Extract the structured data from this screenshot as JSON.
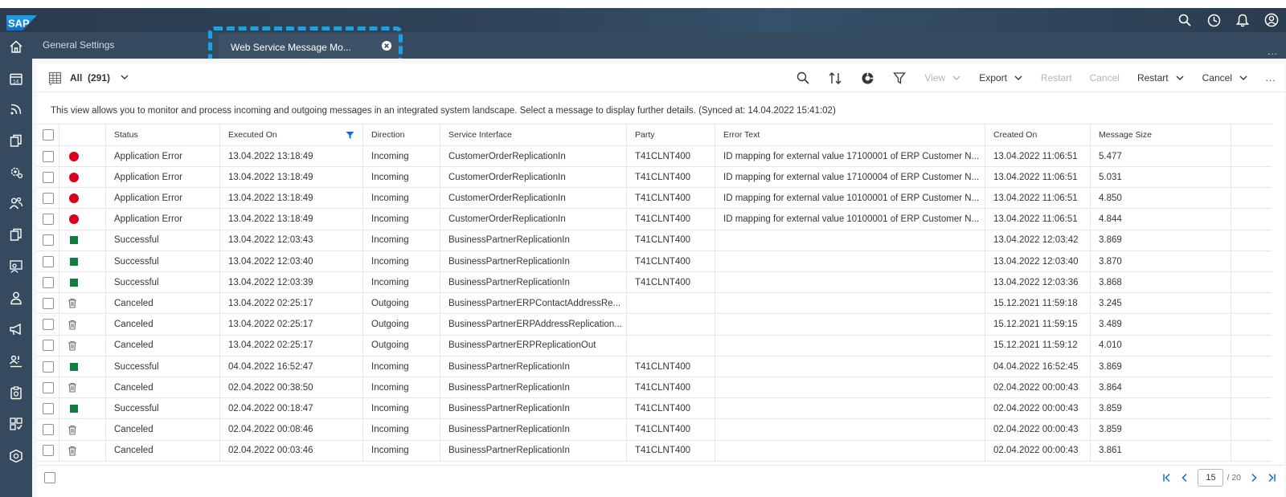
{
  "shell": {
    "logo_text": "SAP",
    "top_icons": [
      "search-icon",
      "history-icon",
      "bell-icon",
      "user-icon"
    ],
    "side_icons": [
      "home-icon",
      "calendar-icon",
      "feed-icon",
      "copy-icon",
      "gear-cluster-icon",
      "people-icon",
      "documents-icon",
      "team-icon",
      "person-icon",
      "megaphone-icon",
      "approval-icon",
      "clipboard-icon",
      "product-icon",
      "shield-icon"
    ]
  },
  "tabs": {
    "general": "General Settings",
    "active": "Web Service Message Mo...",
    "more": "..."
  },
  "toolbar": {
    "title": "All",
    "count": "(291)",
    "view_label": "View",
    "export_label": "Export",
    "restart_disabled": "Restart",
    "cancel_disabled": "Cancel",
    "restart_label": "Restart",
    "cancel_label": "Cancel",
    "more": "..."
  },
  "info": "This view allows you to monitor and process incoming and outgoing messages in an integrated system landscape. Select a message to display further details. (Synced at: 14.04.2022 15:41:02)",
  "columns": [
    "Status",
    "Executed On",
    "Direction",
    "Service Interface",
    "Party",
    "Error Text",
    "Created On",
    "Message Size"
  ],
  "rows": [
    {
      "icon": "error",
      "status": "Application Error",
      "executed": "13.04.2022 13:18:49",
      "direction": "Incoming",
      "service": "CustomerOrderReplicationIn",
      "party": "T41CLNT400",
      "error": "ID mapping for external value 17100001 of ERP Customer N...",
      "created": "13.04.2022 11:06:51",
      "size": "5.477"
    },
    {
      "icon": "error",
      "status": "Application Error",
      "executed": "13.04.2022 13:18:49",
      "direction": "Incoming",
      "service": "CustomerOrderReplicationIn",
      "party": "T41CLNT400",
      "error": "ID mapping for external value 17100004 of ERP Customer N...",
      "created": "13.04.2022 11:06:51",
      "size": "5.031"
    },
    {
      "icon": "error",
      "status": "Application Error",
      "executed": "13.04.2022 13:18:49",
      "direction": "Incoming",
      "service": "CustomerOrderReplicationIn",
      "party": "T41CLNT400",
      "error": "ID mapping for external value 10100001 of ERP Customer N...",
      "created": "13.04.2022 11:06:51",
      "size": "4.850"
    },
    {
      "icon": "error",
      "status": "Application Error",
      "executed": "13.04.2022 13:18:49",
      "direction": "Incoming",
      "service": "CustomerOrderReplicationIn",
      "party": "T41CLNT400",
      "error": "ID mapping for external value 10100001 of ERP Customer N...",
      "created": "13.04.2022 11:06:51",
      "size": "4.844"
    },
    {
      "icon": "success",
      "status": "Successful",
      "executed": "13.04.2022 12:03:43",
      "direction": "Incoming",
      "service": "BusinessPartnerReplicationIn",
      "party": "T41CLNT400",
      "error": "",
      "created": "13.04.2022 12:03:42",
      "size": "3.869"
    },
    {
      "icon": "success",
      "status": "Successful",
      "executed": "13.04.2022 12:03:40",
      "direction": "Incoming",
      "service": "BusinessPartnerReplicationIn",
      "party": "T41CLNT400",
      "error": "",
      "created": "13.04.2022 12:03:40",
      "size": "3.870"
    },
    {
      "icon": "success",
      "status": "Successful",
      "executed": "13.04.2022 12:03:39",
      "direction": "Incoming",
      "service": "BusinessPartnerReplicationIn",
      "party": "T41CLNT400",
      "error": "",
      "created": "13.04.2022 12:03:36",
      "size": "3.868"
    },
    {
      "icon": "canceled",
      "status": "Canceled",
      "executed": "13.04.2022 02:25:17",
      "direction": "Outgoing",
      "service": "BusinessPartnerERPContactAddressRe...",
      "party": "",
      "error": "",
      "created": "15.12.2021 11:59:18",
      "size": "3.245"
    },
    {
      "icon": "canceled",
      "status": "Canceled",
      "executed": "13.04.2022 02:25:17",
      "direction": "Outgoing",
      "service": "BusinessPartnerERPAddressReplication...",
      "party": "",
      "error": "",
      "created": "15.12.2021 11:59:15",
      "size": "3.489"
    },
    {
      "icon": "canceled",
      "status": "Canceled",
      "executed": "13.04.2022 02:25:17",
      "direction": "Outgoing",
      "service": "BusinessPartnerERPReplicationOut",
      "party": "",
      "error": "",
      "created": "15.12.2021 11:59:12",
      "size": "4.010"
    },
    {
      "icon": "success",
      "status": "Successful",
      "executed": "04.04.2022 16:52:47",
      "direction": "Incoming",
      "service": "BusinessPartnerReplicationIn",
      "party": "T41CLNT400",
      "error": "",
      "created": "04.04.2022 16:52:45",
      "size": "3.869"
    },
    {
      "icon": "canceled",
      "status": "Canceled",
      "executed": "02.04.2022 00:38:50",
      "direction": "Incoming",
      "service": "BusinessPartnerReplicationIn",
      "party": "T41CLNT400",
      "error": "",
      "created": "02.04.2022 00:00:43",
      "size": "3.864"
    },
    {
      "icon": "success",
      "status": "Successful",
      "executed": "02.04.2022 00:18:47",
      "direction": "Incoming",
      "service": "BusinessPartnerReplicationIn",
      "party": "T41CLNT400",
      "error": "",
      "created": "02.04.2022 00:00:43",
      "size": "3.859"
    },
    {
      "icon": "canceled",
      "status": "Canceled",
      "executed": "02.04.2022 00:08:46",
      "direction": "Incoming",
      "service": "BusinessPartnerReplicationIn",
      "party": "T41CLNT400",
      "error": "",
      "created": "02.04.2022 00:00:43",
      "size": "3.859"
    },
    {
      "icon": "canceled",
      "status": "Canceled",
      "executed": "02.04.2022 00:03:46",
      "direction": "Incoming",
      "service": "BusinessPartnerReplicationIn",
      "party": "T41CLNT400",
      "error": "",
      "created": "02.04.2022 00:00:43",
      "size": "3.861"
    }
  ],
  "pager": {
    "current": "15",
    "total": "/ 20"
  },
  "colors": {
    "shell": "#354a5f",
    "error": "#d8001a",
    "success": "#107e3e",
    "highlight": "#1aa2e8"
  }
}
